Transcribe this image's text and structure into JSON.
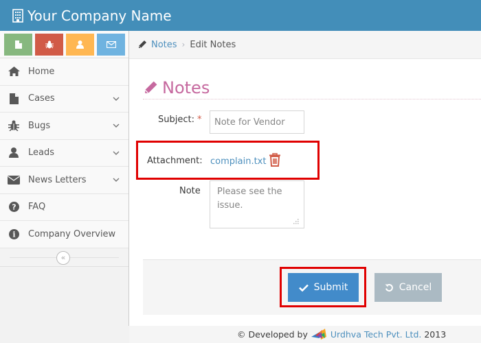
{
  "navbar": {
    "brand": "Your Company Name",
    "brand_icon": "building-icon"
  },
  "sidebar": {
    "shortcuts": [
      {
        "icon": "file-icon",
        "color": "#87b87f"
      },
      {
        "icon": "bug-icon",
        "color": "#d15b47"
      },
      {
        "icon": "user-icon",
        "color": "#ffb752"
      },
      {
        "icon": "envelope-icon",
        "color": "#6fb3e0"
      }
    ],
    "items": [
      {
        "label": "Home",
        "icon": "home-icon",
        "has_submenu": false
      },
      {
        "label": "Cases",
        "icon": "file-icon",
        "has_submenu": true
      },
      {
        "label": "Bugs",
        "icon": "bug-icon",
        "has_submenu": true
      },
      {
        "label": "Leads",
        "icon": "user-icon",
        "has_submenu": true
      },
      {
        "label": "News Letters",
        "icon": "envelope-icon",
        "has_submenu": true
      },
      {
        "label": "FAQ",
        "icon": "question-circle-icon",
        "has_submenu": false
      },
      {
        "label": "Company Overview",
        "icon": "info-circle-icon",
        "has_submenu": false
      }
    ],
    "collapse_label": "«"
  },
  "breadcrumbs": {
    "items": [
      {
        "label": "Notes",
        "link": true
      },
      {
        "label": "Edit Notes",
        "link": false
      }
    ],
    "separator": "›"
  },
  "page": {
    "title": "Notes"
  },
  "form": {
    "subject": {
      "label": "Subject:",
      "required_mark": "*",
      "value": "Note for Vendor"
    },
    "attachment": {
      "label": "Attachment:",
      "file_name": "complain.txt",
      "delete_icon": "trash-icon"
    },
    "note": {
      "label": "Note",
      "value": "Please see the issue."
    },
    "submit_label": "Submit",
    "cancel_label": "Cancel"
  },
  "footer": {
    "prefix": "© Developed by",
    "company": "Urdhva Tech Pvt. Ltd.",
    "year": "2013"
  },
  "colors": {
    "navbar": "#438eb9",
    "title_pink": "#c6699f",
    "link_blue": "#4c8fbd",
    "primary_button": "#428bca",
    "cancel_button": "#abbac3",
    "highlight_red": "#e00000",
    "trash_red": "#d15b47"
  }
}
